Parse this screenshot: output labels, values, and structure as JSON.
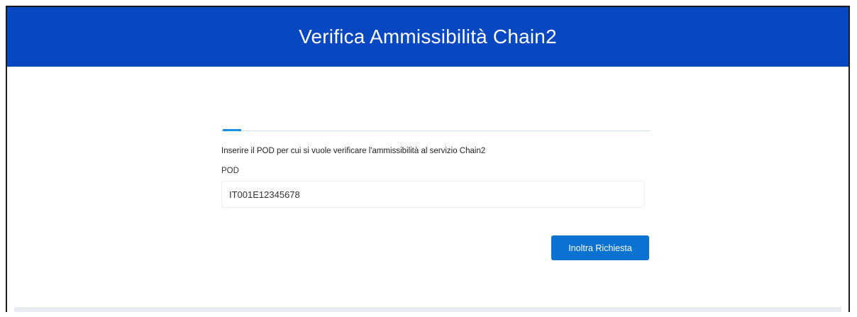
{
  "header": {
    "title": "Verifica Ammissibilità Chain2"
  },
  "form": {
    "instruction": "Inserire il POD per cui si vuole verificare l'ammissibilità al servizio Chain2",
    "pod_label": "POD",
    "pod_value": "IT001E12345678",
    "submit_label": "Inoltra Richiesta"
  },
  "colors": {
    "header_background": "#0747c2",
    "button_background": "#0a72d1",
    "tab_indicator": "#1b8fe6"
  }
}
